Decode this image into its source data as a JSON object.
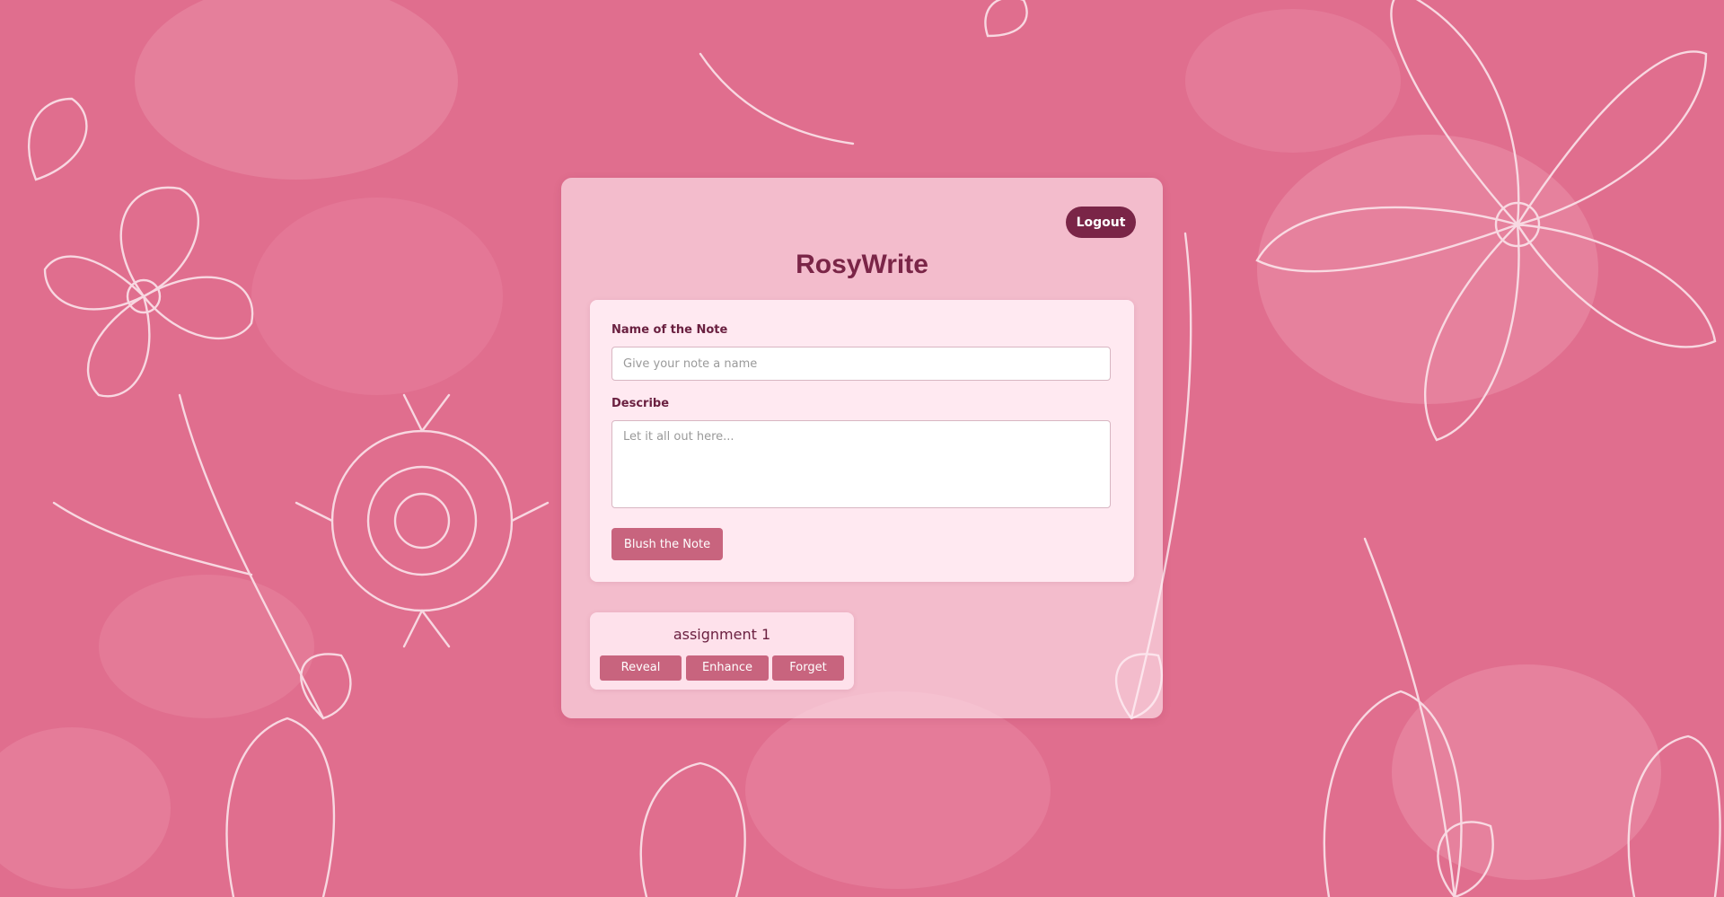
{
  "app": {
    "title": "RosyWrite"
  },
  "header": {
    "logout_label": "Logout"
  },
  "form": {
    "name_label": "Name of the Note",
    "name_placeholder": "Give your note a name",
    "name_value": "",
    "describe_label": "Describe",
    "describe_placeholder": "Let it all out here...",
    "describe_value": "",
    "submit_label": "Blush the Note"
  },
  "notes": [
    {
      "title": "assignment 1",
      "actions": {
        "reveal": "Reveal",
        "enhance": "Enhance",
        "forget": "Forget"
      }
    }
  ],
  "colors": {
    "background": "#e06e8e",
    "accent": "#7a2547",
    "button": "#c8647e"
  }
}
